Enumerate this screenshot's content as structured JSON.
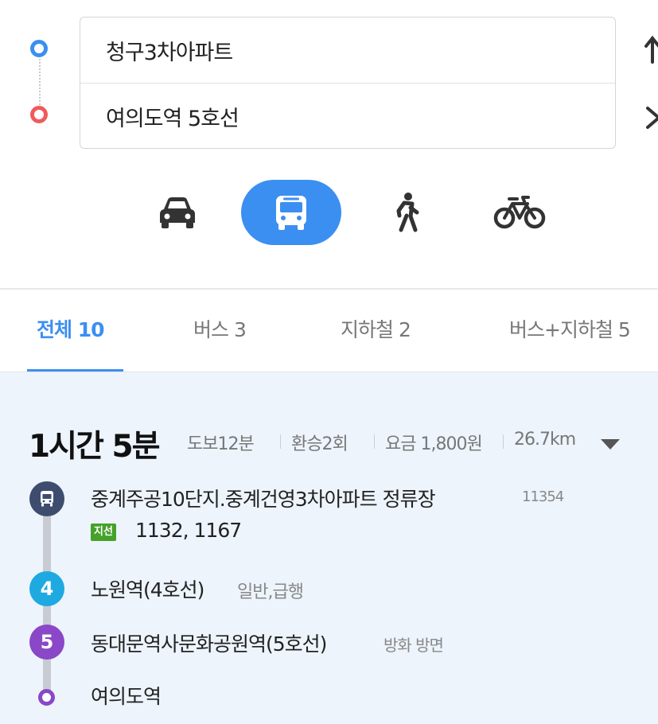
{
  "search": {
    "origin": "청구3차아파트",
    "destination": "여의도역 5호선"
  },
  "modes": [
    "car-icon",
    "bus-icon",
    "walk-icon",
    "bike-icon"
  ],
  "active_mode": "bus",
  "tabs": [
    {
      "label": "전체 10",
      "active": true
    },
    {
      "label": "버스 3",
      "active": false
    },
    {
      "label": "지하철 2",
      "active": false
    },
    {
      "label": "버스+지하철 5",
      "active": false
    }
  ],
  "result": {
    "duration": "1시간 5분",
    "walk": "도보12분",
    "transfers": "환승2회",
    "fare": "요금 1,800원",
    "distance": "26.7km",
    "steps": {
      "bus_stop": {
        "name": "중계주공10단지.중계건영3차아파트 정류장",
        "stop_id": "11354",
        "badge": "지선",
        "routes": "1132, 1167"
      },
      "subway1": {
        "line": "4",
        "name": "노원역(4호선)",
        "note": "일반,급행"
      },
      "subway2": {
        "line": "5",
        "name": "동대문역사문화공원역(5호선)",
        "note": "방화 방면"
      },
      "end": {
        "name": "여의도역"
      }
    }
  },
  "colors": {
    "accent": "#3b8ff1",
    "origin_dot": "#3a8ff0",
    "dest_dot": "#ef5b5b",
    "bus_marker": "#3e4d6e",
    "line4": "#1ea9e1",
    "line5": "#8a47c8",
    "branch_badge": "#46a12a",
    "result_bg": "#edf4fc"
  }
}
